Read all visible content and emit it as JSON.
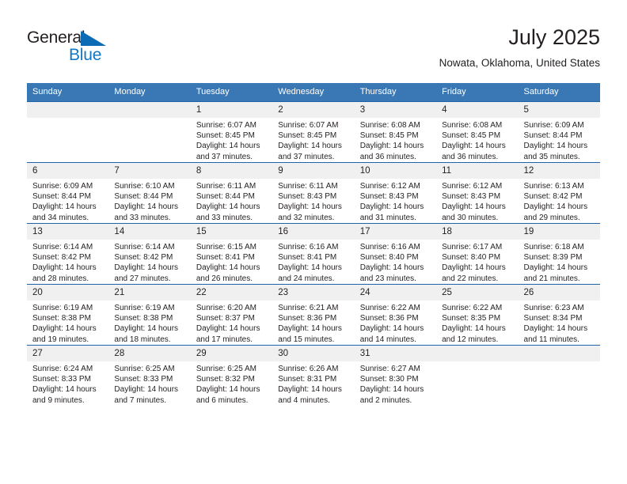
{
  "brand": {
    "name_part1": "General",
    "name_part2": "Blue",
    "logo_icon": "triangle-icon",
    "colors": {
      "blue": "#1277c4",
      "dark": "#231f20"
    }
  },
  "header": {
    "title": "July 2025",
    "location": "Nowata, Oklahoma, United States"
  },
  "theme": {
    "header_row_bg": "#3a78b5",
    "row_divider": "#1f63a8",
    "daynum_bg": "#f0f0f0"
  },
  "calendar": {
    "weekday_headers": [
      "Sunday",
      "Monday",
      "Tuesday",
      "Wednesday",
      "Thursday",
      "Friday",
      "Saturday"
    ],
    "weeks": [
      [
        {
          "day": "",
          "sunrise": "",
          "sunset": "",
          "daylight_line1": "",
          "daylight_line2": ""
        },
        {
          "day": "",
          "sunrise": "",
          "sunset": "",
          "daylight_line1": "",
          "daylight_line2": ""
        },
        {
          "day": "1",
          "sunrise": "Sunrise: 6:07 AM",
          "sunset": "Sunset: 8:45 PM",
          "daylight_line1": "Daylight: 14 hours",
          "daylight_line2": "and 37 minutes."
        },
        {
          "day": "2",
          "sunrise": "Sunrise: 6:07 AM",
          "sunset": "Sunset: 8:45 PM",
          "daylight_line1": "Daylight: 14 hours",
          "daylight_line2": "and 37 minutes."
        },
        {
          "day": "3",
          "sunrise": "Sunrise: 6:08 AM",
          "sunset": "Sunset: 8:45 PM",
          "daylight_line1": "Daylight: 14 hours",
          "daylight_line2": "and 36 minutes."
        },
        {
          "day": "4",
          "sunrise": "Sunrise: 6:08 AM",
          "sunset": "Sunset: 8:45 PM",
          "daylight_line1": "Daylight: 14 hours",
          "daylight_line2": "and 36 minutes."
        },
        {
          "day": "5",
          "sunrise": "Sunrise: 6:09 AM",
          "sunset": "Sunset: 8:44 PM",
          "daylight_line1": "Daylight: 14 hours",
          "daylight_line2": "and 35 minutes."
        }
      ],
      [
        {
          "day": "6",
          "sunrise": "Sunrise: 6:09 AM",
          "sunset": "Sunset: 8:44 PM",
          "daylight_line1": "Daylight: 14 hours",
          "daylight_line2": "and 34 minutes."
        },
        {
          "day": "7",
          "sunrise": "Sunrise: 6:10 AM",
          "sunset": "Sunset: 8:44 PM",
          "daylight_line1": "Daylight: 14 hours",
          "daylight_line2": "and 33 minutes."
        },
        {
          "day": "8",
          "sunrise": "Sunrise: 6:11 AM",
          "sunset": "Sunset: 8:44 PM",
          "daylight_line1": "Daylight: 14 hours",
          "daylight_line2": "and 33 minutes."
        },
        {
          "day": "9",
          "sunrise": "Sunrise: 6:11 AM",
          "sunset": "Sunset: 8:43 PM",
          "daylight_line1": "Daylight: 14 hours",
          "daylight_line2": "and 32 minutes."
        },
        {
          "day": "10",
          "sunrise": "Sunrise: 6:12 AM",
          "sunset": "Sunset: 8:43 PM",
          "daylight_line1": "Daylight: 14 hours",
          "daylight_line2": "and 31 minutes."
        },
        {
          "day": "11",
          "sunrise": "Sunrise: 6:12 AM",
          "sunset": "Sunset: 8:43 PM",
          "daylight_line1": "Daylight: 14 hours",
          "daylight_line2": "and 30 minutes."
        },
        {
          "day": "12",
          "sunrise": "Sunrise: 6:13 AM",
          "sunset": "Sunset: 8:42 PM",
          "daylight_line1": "Daylight: 14 hours",
          "daylight_line2": "and 29 minutes."
        }
      ],
      [
        {
          "day": "13",
          "sunrise": "Sunrise: 6:14 AM",
          "sunset": "Sunset: 8:42 PM",
          "daylight_line1": "Daylight: 14 hours",
          "daylight_line2": "and 28 minutes."
        },
        {
          "day": "14",
          "sunrise": "Sunrise: 6:14 AM",
          "sunset": "Sunset: 8:42 PM",
          "daylight_line1": "Daylight: 14 hours",
          "daylight_line2": "and 27 minutes."
        },
        {
          "day": "15",
          "sunrise": "Sunrise: 6:15 AM",
          "sunset": "Sunset: 8:41 PM",
          "daylight_line1": "Daylight: 14 hours",
          "daylight_line2": "and 26 minutes."
        },
        {
          "day": "16",
          "sunrise": "Sunrise: 6:16 AM",
          "sunset": "Sunset: 8:41 PM",
          "daylight_line1": "Daylight: 14 hours",
          "daylight_line2": "and 24 minutes."
        },
        {
          "day": "17",
          "sunrise": "Sunrise: 6:16 AM",
          "sunset": "Sunset: 8:40 PM",
          "daylight_line1": "Daylight: 14 hours",
          "daylight_line2": "and 23 minutes."
        },
        {
          "day": "18",
          "sunrise": "Sunrise: 6:17 AM",
          "sunset": "Sunset: 8:40 PM",
          "daylight_line1": "Daylight: 14 hours",
          "daylight_line2": "and 22 minutes."
        },
        {
          "day": "19",
          "sunrise": "Sunrise: 6:18 AM",
          "sunset": "Sunset: 8:39 PM",
          "daylight_line1": "Daylight: 14 hours",
          "daylight_line2": "and 21 minutes."
        }
      ],
      [
        {
          "day": "20",
          "sunrise": "Sunrise: 6:19 AM",
          "sunset": "Sunset: 8:38 PM",
          "daylight_line1": "Daylight: 14 hours",
          "daylight_line2": "and 19 minutes."
        },
        {
          "day": "21",
          "sunrise": "Sunrise: 6:19 AM",
          "sunset": "Sunset: 8:38 PM",
          "daylight_line1": "Daylight: 14 hours",
          "daylight_line2": "and 18 minutes."
        },
        {
          "day": "22",
          "sunrise": "Sunrise: 6:20 AM",
          "sunset": "Sunset: 8:37 PM",
          "daylight_line1": "Daylight: 14 hours",
          "daylight_line2": "and 17 minutes."
        },
        {
          "day": "23",
          "sunrise": "Sunrise: 6:21 AM",
          "sunset": "Sunset: 8:36 PM",
          "daylight_line1": "Daylight: 14 hours",
          "daylight_line2": "and 15 minutes."
        },
        {
          "day": "24",
          "sunrise": "Sunrise: 6:22 AM",
          "sunset": "Sunset: 8:36 PM",
          "daylight_line1": "Daylight: 14 hours",
          "daylight_line2": "and 14 minutes."
        },
        {
          "day": "25",
          "sunrise": "Sunrise: 6:22 AM",
          "sunset": "Sunset: 8:35 PM",
          "daylight_line1": "Daylight: 14 hours",
          "daylight_line2": "and 12 minutes."
        },
        {
          "day": "26",
          "sunrise": "Sunrise: 6:23 AM",
          "sunset": "Sunset: 8:34 PM",
          "daylight_line1": "Daylight: 14 hours",
          "daylight_line2": "and 11 minutes."
        }
      ],
      [
        {
          "day": "27",
          "sunrise": "Sunrise: 6:24 AM",
          "sunset": "Sunset: 8:33 PM",
          "daylight_line1": "Daylight: 14 hours",
          "daylight_line2": "and 9 minutes."
        },
        {
          "day": "28",
          "sunrise": "Sunrise: 6:25 AM",
          "sunset": "Sunset: 8:33 PM",
          "daylight_line1": "Daylight: 14 hours",
          "daylight_line2": "and 7 minutes."
        },
        {
          "day": "29",
          "sunrise": "Sunrise: 6:25 AM",
          "sunset": "Sunset: 8:32 PM",
          "daylight_line1": "Daylight: 14 hours",
          "daylight_line2": "and 6 minutes."
        },
        {
          "day": "30",
          "sunrise": "Sunrise: 6:26 AM",
          "sunset": "Sunset: 8:31 PM",
          "daylight_line1": "Daylight: 14 hours",
          "daylight_line2": "and 4 minutes."
        },
        {
          "day": "31",
          "sunrise": "Sunrise: 6:27 AM",
          "sunset": "Sunset: 8:30 PM",
          "daylight_line1": "Daylight: 14 hours",
          "daylight_line2": "and 2 minutes."
        },
        {
          "day": "",
          "sunrise": "",
          "sunset": "",
          "daylight_line1": "",
          "daylight_line2": ""
        },
        {
          "day": "",
          "sunrise": "",
          "sunset": "",
          "daylight_line1": "",
          "daylight_line2": ""
        }
      ]
    ]
  }
}
